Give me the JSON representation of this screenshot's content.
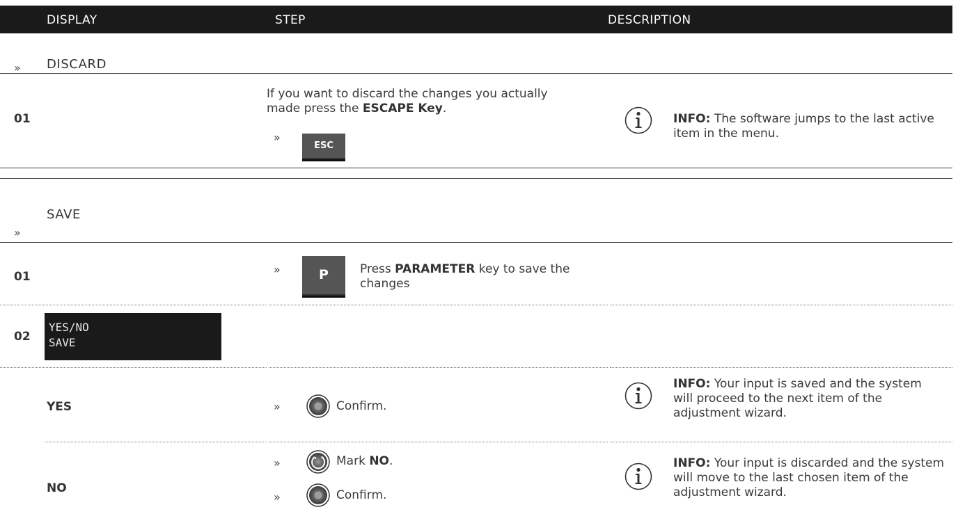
{
  "header": {
    "col_display": "DISPLAY",
    "col_step": "STEP",
    "col_description": "DESCRIPTION"
  },
  "bullet": "»",
  "discard": {
    "title": "DISCARD",
    "row1": {
      "number": "01",
      "step_pre": "If you want to discard the changes you actually made press the ",
      "step_bold": "ESCAPE Key",
      "step_post": ".",
      "key_label": "ESC",
      "info_bold": "INFO:",
      "info_text": " The software jumps to the last active item in the menu."
    }
  },
  "save": {
    "title": "SAVE",
    "row1": {
      "number": "01",
      "key_label": "P",
      "step_pre": "Press ",
      "step_bold": "PARAMETER",
      "step_post": " key to save the changes"
    },
    "row2": {
      "number": "02",
      "lcd_line1": "YES/NO",
      "lcd_line2": "SAVE"
    },
    "yes": {
      "label": "YES",
      "step": "Confirm.",
      "info_bold": "INFO:",
      "info_text": " Your input is saved and the system will proceed to the next item of the adjustment wizard."
    },
    "no": {
      "label": "NO",
      "step1_pre": "Mark ",
      "step1_bold": "NO",
      "step1_post": ".",
      "step2": "Confirm.",
      "info_bold": "INFO:",
      "info_text": " Your input is discarded and the system will move to the last chosen item of the adjustment wizard."
    }
  },
  "icons": [
    "info-icon",
    "esc-key-icon",
    "p-key-icon",
    "confirm-knob-icon",
    "rotate-knob-icon"
  ]
}
